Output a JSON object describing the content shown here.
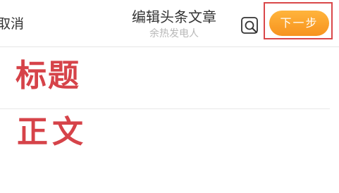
{
  "header": {
    "cancel_label": "取消",
    "title": "编辑头条文章",
    "subtitle": "余热发电人",
    "preview_icon": "search-preview-icon",
    "next_label": "下一步"
  },
  "editor": {
    "title_placeholder": "标题",
    "body_placeholder": "正文"
  },
  "colors": {
    "accent_gradient_top": "#ffb43c",
    "accent_gradient_bottom": "#f7931e",
    "highlight_border": "#d9474a",
    "placeholder_red": "#d64349"
  }
}
